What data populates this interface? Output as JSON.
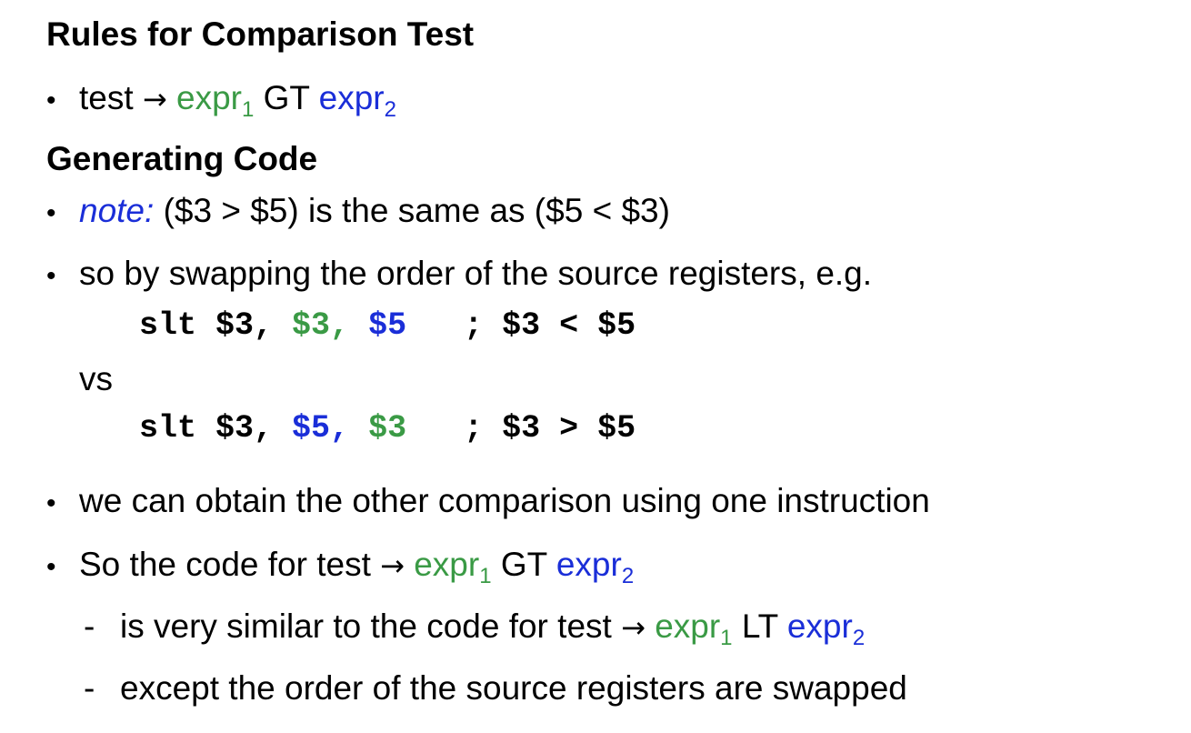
{
  "colors": {
    "green": "#3a9a45",
    "blue": "#1a2ed8"
  },
  "heading_rules": "Rules for Comparison Test",
  "rule_bullet": {
    "lead": "test ",
    "arrow": "→",
    "expr1": "expr",
    "expr1_sub": "1",
    "op": "GT",
    "expr2": "expr",
    "expr2_sub": "2"
  },
  "heading_generating": "Generating Code",
  "note_bullet": {
    "note_label": "note:",
    "text": "($3 > $5) is the same as ($5 < $3)"
  },
  "swap_bullet": "so by swapping the order of the source registers, e.g.",
  "code1": {
    "instr": "slt $3, ",
    "src_a": "$3,",
    "src_b": "$5",
    "comment": "; $3 < $5"
  },
  "vs": "vs",
  "code2": {
    "instr": "slt $3, ",
    "src_a": "$5,",
    "src_b": "$3",
    "comment": "; $3 > $5"
  },
  "obtain_bullet": "we can obtain the other comparison using one instruction",
  "so_bullet": {
    "lead": "So the code for test ",
    "arrow": "→",
    "expr1": "expr",
    "expr1_sub": "1",
    "op": "GT",
    "expr2": "expr",
    "expr2_sub": "2"
  },
  "sub1": {
    "lead": "is very similar to the code for test ",
    "arrow": "→",
    "expr1": "expr",
    "expr1_sub": "1",
    "op": "LT",
    "expr2": "expr",
    "expr2_sub": "2"
  },
  "sub2": "except the order of the source registers are swapped"
}
